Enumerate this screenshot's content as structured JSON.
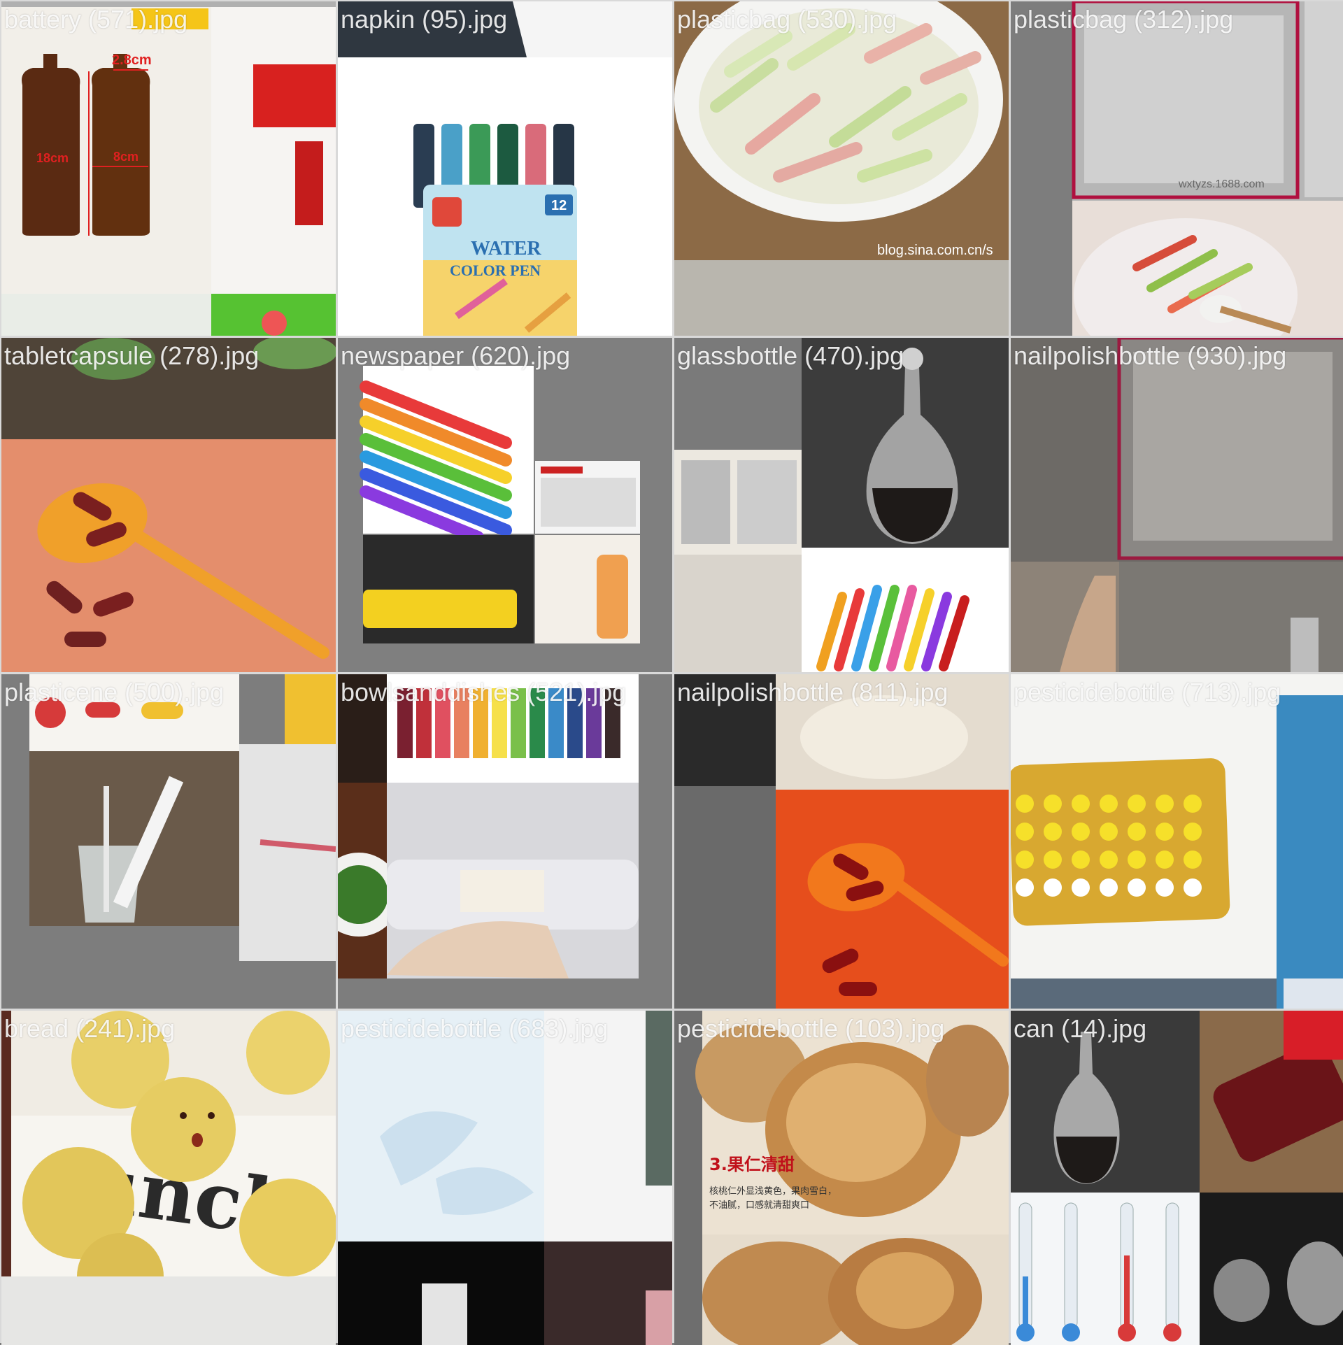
{
  "tiles": [
    {
      "caption": "battery (571).jpg"
    },
    {
      "caption": "napkin (95).jpg"
    },
    {
      "caption": "plasticbag (530).jpg"
    },
    {
      "caption": "plasticbag (312).jpg"
    },
    {
      "caption": "tabletcapsule (278).jpg"
    },
    {
      "caption": "newspaper (620).jpg"
    },
    {
      "caption": "glassbottle (470).jpg"
    },
    {
      "caption": "nailpolishbottle (930).jpg"
    },
    {
      "caption": "plasticene (500).jpg"
    },
    {
      "caption": "bowlsanddishes (521).jpg"
    },
    {
      "caption": "nailpolishbottle (811).jpg"
    },
    {
      "caption": "pesticidebottle (713).jpg"
    },
    {
      "caption": "bread (241).jpg"
    },
    {
      "caption": "pesticidebottle (683).jpg"
    },
    {
      "caption": "pesticidebottle (103).jpg"
    },
    {
      "caption": "can (14).jpg"
    }
  ],
  "overlays": {
    "bottle_dims": [
      "2.8cm",
      "18cm",
      "8cm"
    ],
    "watermark_sina": "blog.sina.com.cn/s",
    "watermark_1688": "wxtyzs.1688.com",
    "marker_pack": [
      "12",
      "WATER",
      "COLOR PEN"
    ],
    "walnut_heading": "3.果仁清甜",
    "walnut_text": [
      "核桃仁外显浅黄色，果肉雪白，",
      "不油腻，口感就清甜爽口"
    ]
  }
}
